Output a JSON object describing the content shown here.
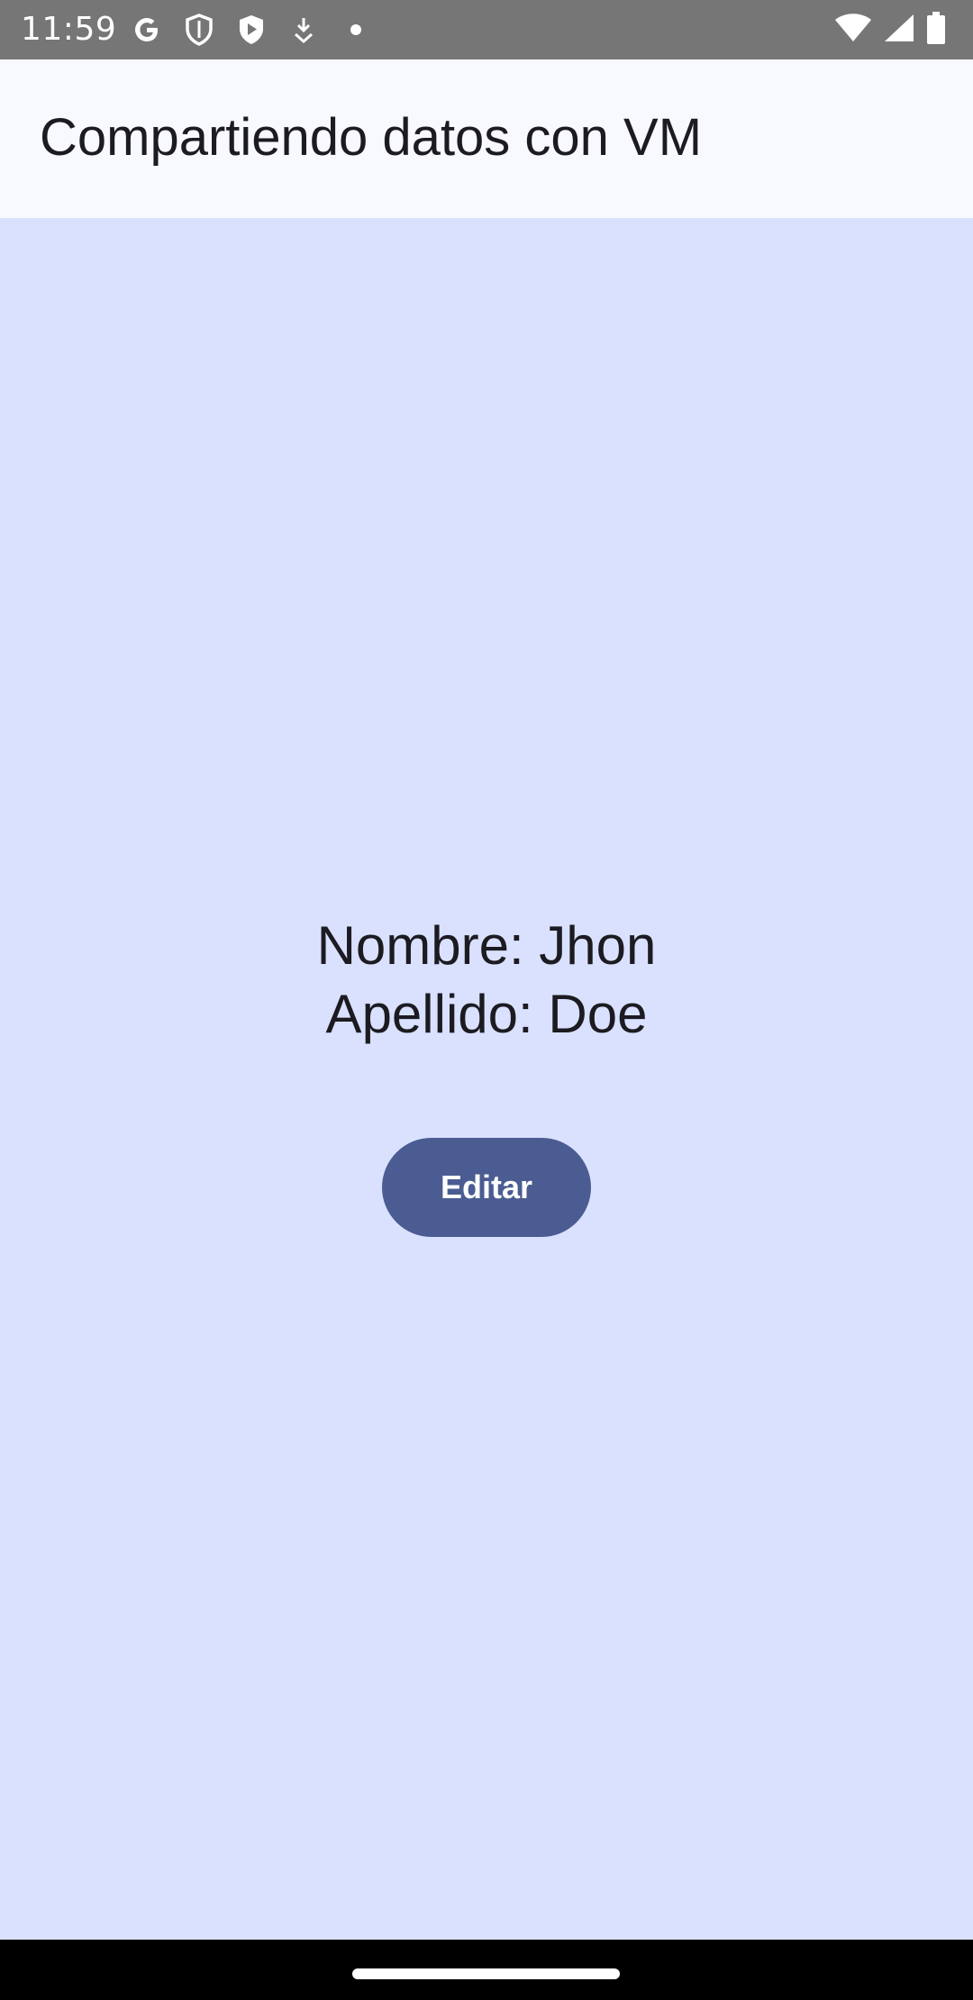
{
  "status_bar": {
    "time": "11:59",
    "left_icons": [
      "google-icon",
      "shield-icon",
      "play-protect-icon",
      "download-icon",
      "dot-icon"
    ],
    "right_icons": [
      "wifi-icon",
      "signal-icon",
      "battery-icon"
    ]
  },
  "app_bar": {
    "title": "Compartiendo datos con VM"
  },
  "main": {
    "name_line": "Nombre: Jhon",
    "surname_line": "Apellido: Doe",
    "edit_label": "Editar"
  },
  "colors": {
    "status_bar_bg": "#767676",
    "app_bar_bg": "#f8f8ff",
    "content_bg": "#dae1fe",
    "button_bg": "#4a5c92",
    "text": "#1b1b21"
  }
}
